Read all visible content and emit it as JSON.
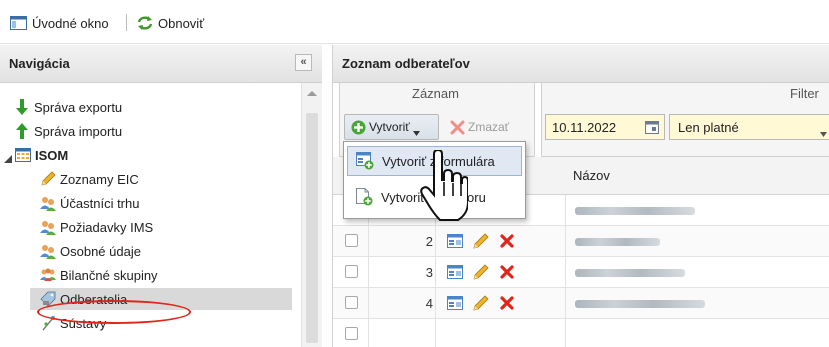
{
  "toolbar": {
    "home_label": "Úvodné okno",
    "refresh_label": "Obnoviť"
  },
  "navigation": {
    "title": "Navigácia",
    "collapse_glyph": "«",
    "items": [
      {
        "label": "Správa exportu",
        "icon": "arrow-down-icon"
      },
      {
        "label": "Správa importu",
        "icon": "arrow-up-icon"
      },
      {
        "label": "ISOM",
        "icon": "grid-icon",
        "expanded": true
      },
      {
        "label": "Zoznamy EIC",
        "icon": "pencil-icon"
      },
      {
        "label": "Účastníci trhu",
        "icon": "users-icon"
      },
      {
        "label": "Požiadavky IMS",
        "icon": "users-icon"
      },
      {
        "label": "Osobné údaje",
        "icon": "users-icon"
      },
      {
        "label": "Bilančné skupiny",
        "icon": "group-icon"
      },
      {
        "label": "Odberatelia",
        "icon": "tag-icon",
        "selected": true
      },
      {
        "label": "Sústavy",
        "icon": "branch-icon"
      }
    ]
  },
  "main": {
    "title": "Zoznam odberateľov",
    "record_group_label": "Záznam",
    "filter_group_label": "Filter",
    "create_label": "Vytvoriť",
    "delete_label": "Zmazať",
    "date_value": "10.11.2022",
    "validity_value": "Len platné",
    "column_name": "Názov",
    "rows": [
      {
        "num": "2",
        "blur_width": 0.42
      },
      {
        "num": "3",
        "blur_width": 0.55
      },
      {
        "num": "4",
        "blur_width": 0.65
      }
    ]
  },
  "dropdown": {
    "items": [
      {
        "label": "Vytvoriť z formulára",
        "icon": "form-add-icon"
      },
      {
        "label": "Vytvoriť zo súboru",
        "icon": "file-add-icon"
      }
    ]
  },
  "colors": {
    "accent_red": "#e0261b",
    "selected_bg": "#d9d9d9",
    "input_bg": "#fff9d6",
    "menu_hover": "#dfe8f3"
  }
}
